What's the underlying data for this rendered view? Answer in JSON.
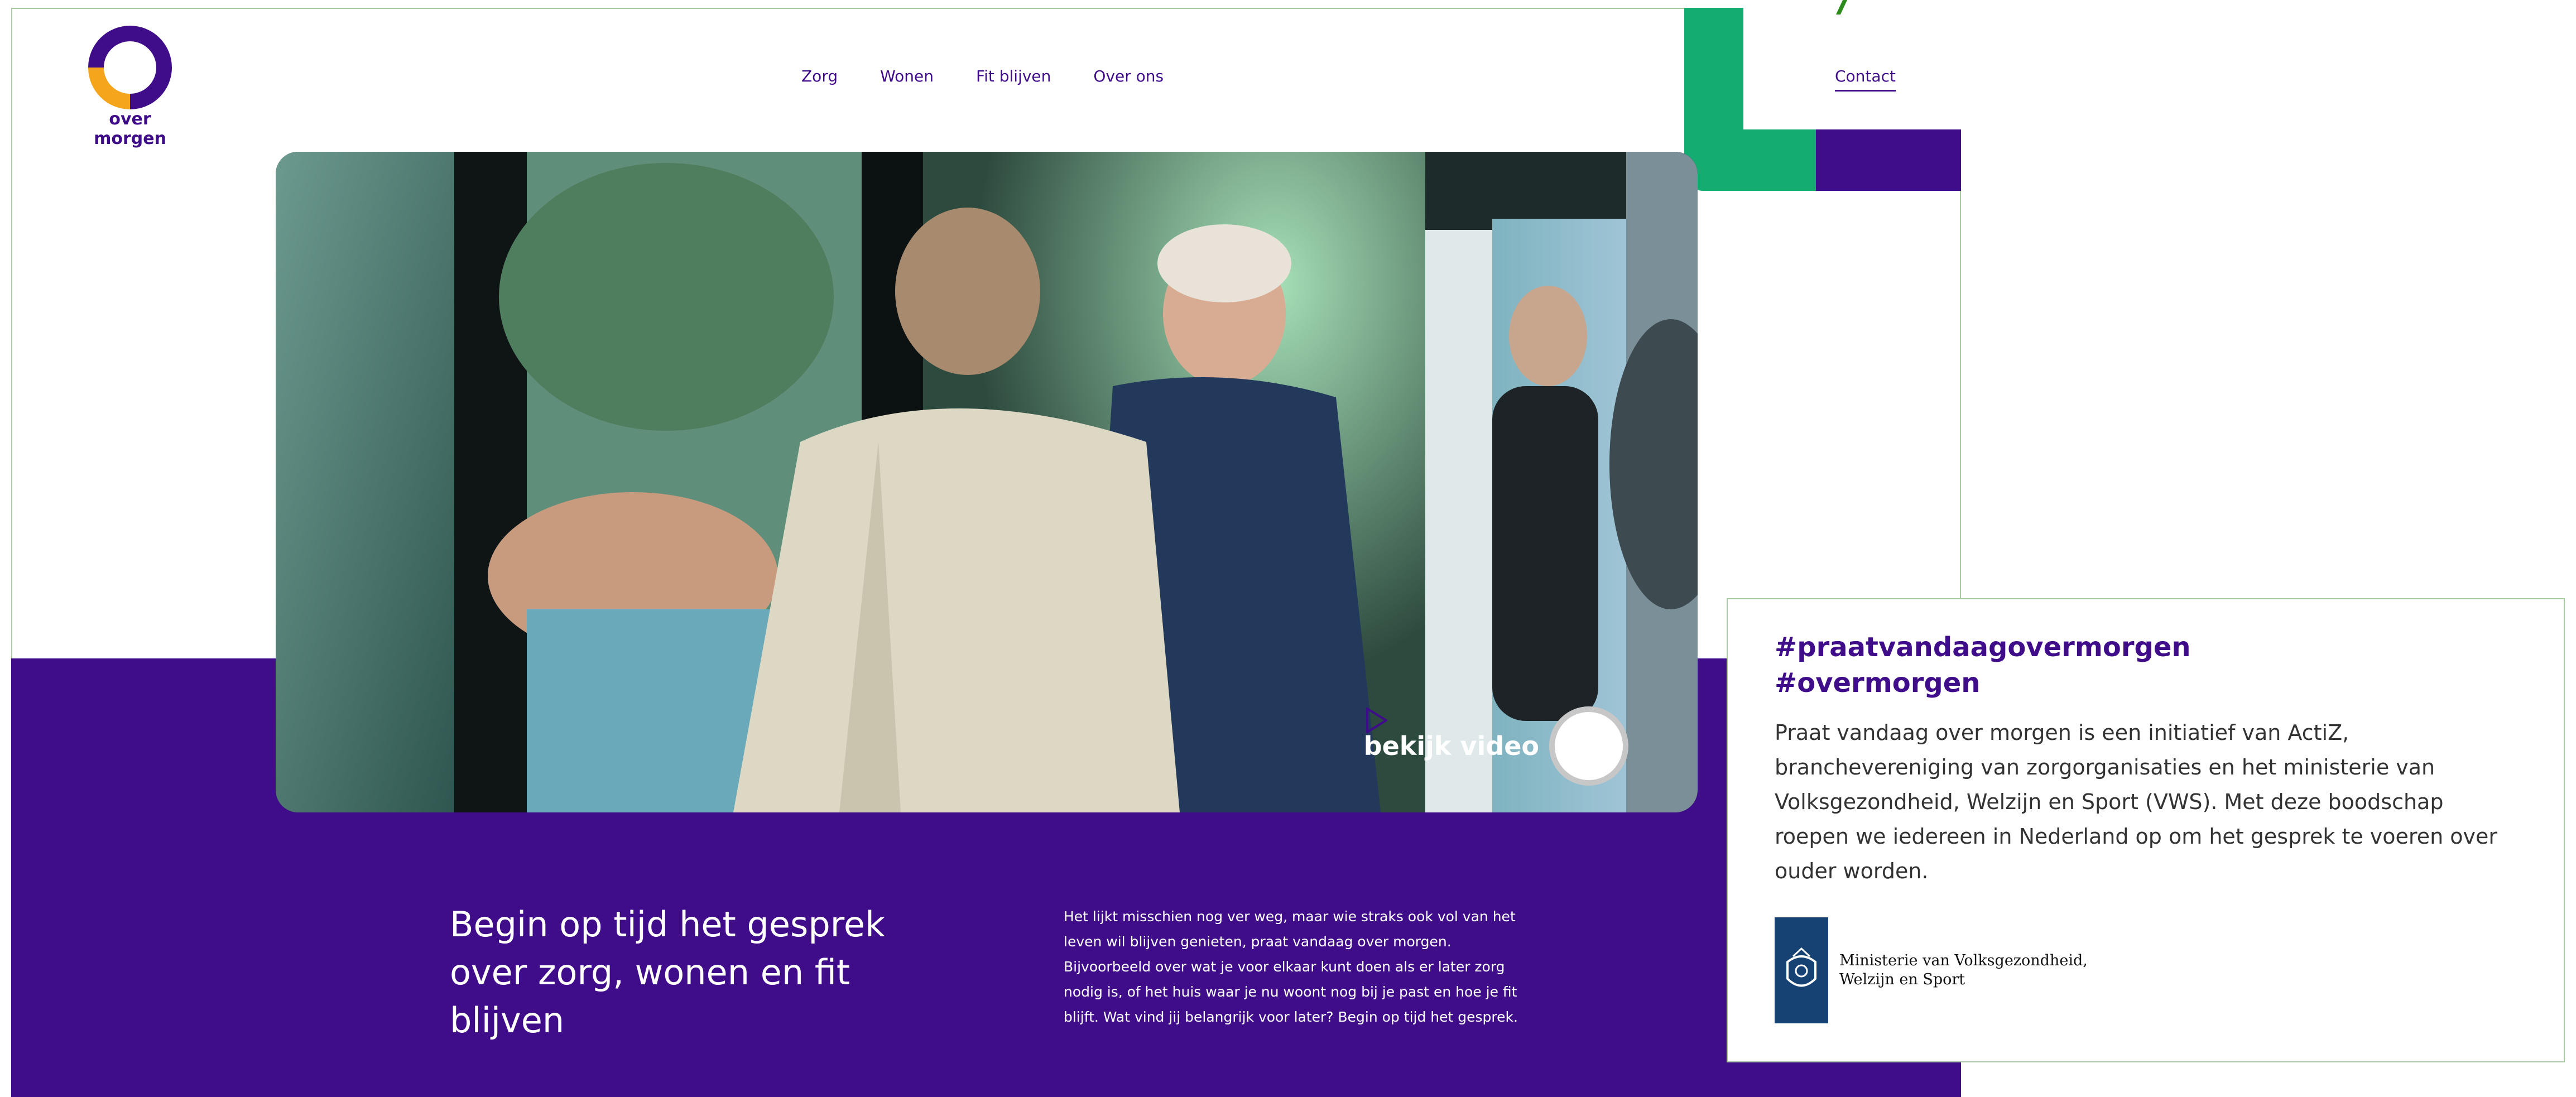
{
  "brand": {
    "logo_text": "over morgen",
    "colors": {
      "purple": "#3f0c8a",
      "yellow": "#f4a51c",
      "green": "#14ac71"
    }
  },
  "nav": {
    "items": [
      {
        "label": "Zorg"
      },
      {
        "label": "Wonen"
      },
      {
        "label": "Fit blijven"
      },
      {
        "label": "Over ons"
      }
    ],
    "contact_label": "Contact"
  },
  "hero": {
    "video_cta": "bekijk video",
    "play_icon": "play-icon"
  },
  "intro": {
    "headline_line1": "Begin op tijd het gesprek",
    "headline_line2": "over zorg, wonen en fit blijven",
    "body": "Het lijkt misschien nog ver weg, maar wie straks ook vol van het leven wil blijven genieten, praat vandaag over morgen. Bijvoorbeeld over wat je voor elkaar kunt doen als er later zorg nodig is, of het huis waar je nu woont nog bij je past en hoe je fit blijft. Wat vind jij belangrijk voor later? Begin op tijd het gesprek."
  },
  "info_card": {
    "hashtag1": "#praatvandaagovermorgen",
    "hashtag2": "#overmorgen",
    "text": "Praat vandaag over morgen is een initiatief van ActiZ, branchevereniging van zorgorganisaties en het ministerie van Volksgezondheid, Welzijn en Sport (VWS). Met deze boodschap roepen we iedereen in Nederland op om het gesprek te voeren over ouder worden.",
    "ministry_line1": "Ministerie van Volksgezondheid,",
    "ministry_line2": "Welzijn en Sport"
  }
}
